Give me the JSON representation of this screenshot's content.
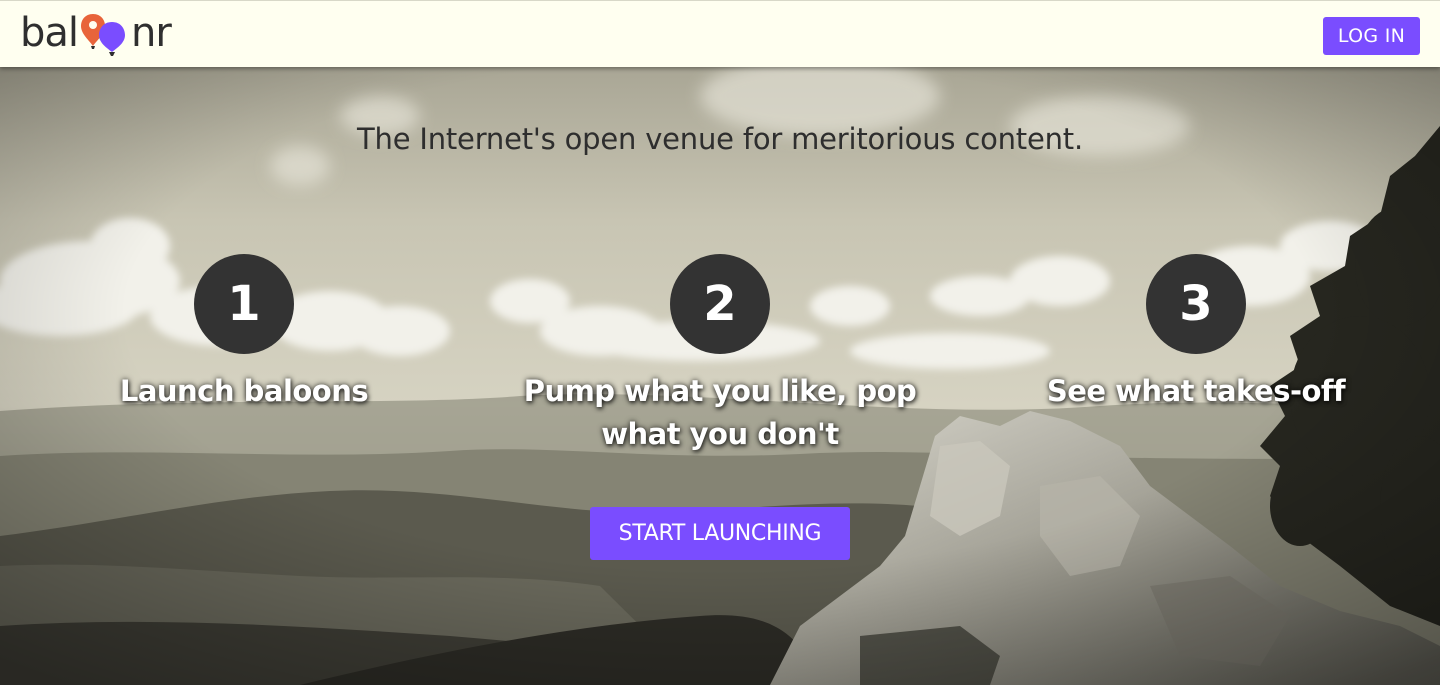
{
  "brand": {
    "name_left": "bal",
    "name_right": "nr",
    "logo_icon": "balloons-logo-icon",
    "accent_color": "#7a4dff",
    "balloon_colors": [
      "#e8643a",
      "#7a4dff"
    ]
  },
  "navbar": {
    "login_label": "LOG IN"
  },
  "hero": {
    "tagline": "The Internet's open venue for meritorious content.",
    "steps": [
      {
        "number": "1",
        "label": "Launch baloons"
      },
      {
        "number": "2",
        "label": "Pump what you like, pop what you don't"
      },
      {
        "number": "3",
        "label": "See what takes-off"
      }
    ],
    "cta_label": "START LAUNCHING",
    "background": "sepia-mountain-landscape"
  }
}
